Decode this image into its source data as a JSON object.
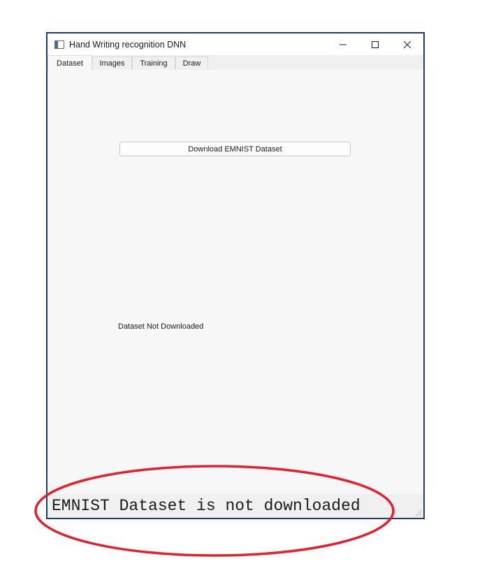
{
  "window": {
    "title": "Hand Writing recognition DNN",
    "icon": "app-window-icon"
  },
  "controls": {
    "minimize": "–",
    "maximize": "☐",
    "close": "✕"
  },
  "tabs": [
    {
      "label": "Dataset",
      "active": true
    },
    {
      "label": "Images",
      "active": false
    },
    {
      "label": "Training",
      "active": false
    },
    {
      "label": "Draw",
      "active": false
    }
  ],
  "dataset_tab": {
    "download_button": "Download EMNIST Dataset",
    "status_label": "Dataset Not Downloaded"
  },
  "statusbar": {
    "message": "EMNIST Dataset is not downloaded"
  },
  "annotation": {
    "shape": "ellipse",
    "color": "#e3202b"
  }
}
